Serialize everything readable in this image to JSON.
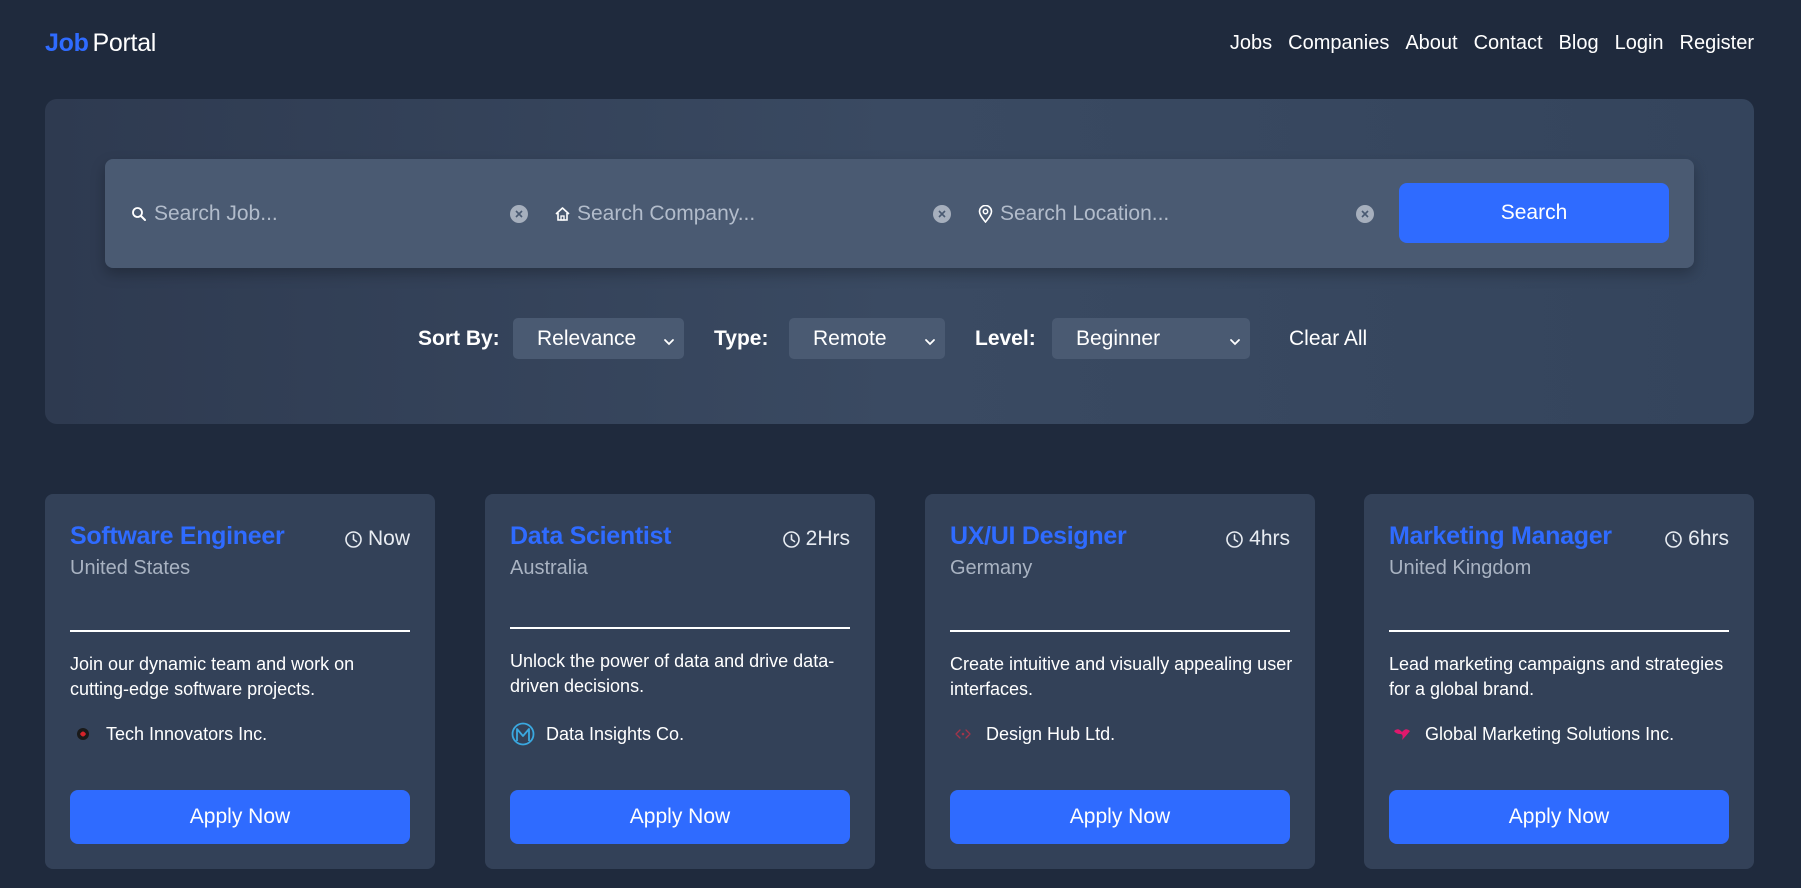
{
  "brand": {
    "part1": "Job",
    "part2": "Portal",
    "accent": "#2f6bff"
  },
  "nav": [
    "Jobs",
    "Companies",
    "About",
    "Contact",
    "Blog",
    "Login",
    "Register"
  ],
  "search": {
    "job_placeholder": "Search Job...",
    "company_placeholder": "Search Company...",
    "location_placeholder": "Search Location...",
    "button": "Search",
    "icons": {
      "job": "search-icon",
      "company": "home-icon",
      "location": "location-pin-icon",
      "clear": "clear-icon"
    }
  },
  "filters": {
    "sort_label": "Sort By:",
    "sort_value": "Relevance",
    "type_label": "Type:",
    "type_value": "Remote",
    "level_label": "Level:",
    "level_value": "Beginner",
    "clear_all": "Clear All"
  },
  "jobs": [
    {
      "title": "Software Engineer",
      "time": "Now",
      "location": "United States",
      "description": "Join our dynamic team and work on cutting-edge software projects.",
      "company": "Tech Innovators Inc.",
      "company_logo": "tech-innovators-logo",
      "apply": "Apply Now"
    },
    {
      "title": "Data Scientist",
      "time": "2Hrs",
      "location": "Australia",
      "description": "Unlock the power of data and drive data-driven decisions.",
      "company": "Data Insights Co.",
      "company_logo": "data-insights-logo",
      "apply": "Apply Now"
    },
    {
      "title": "UX/UI Designer",
      "time": "4hrs",
      "location": "Germany",
      "description": "Create intuitive and visually appealing user interfaces.",
      "company": "Design Hub Ltd.",
      "company_logo": "design-hub-logo",
      "apply": "Apply Now"
    },
    {
      "title": "Marketing Manager",
      "time": "6hrs",
      "location": "United Kingdom",
      "description": "Lead marketing campaigns and strategies for a global brand.",
      "company": "Global Marketing Solutions Inc.",
      "company_logo": "global-marketing-logo",
      "apply": "Apply Now"
    }
  ]
}
